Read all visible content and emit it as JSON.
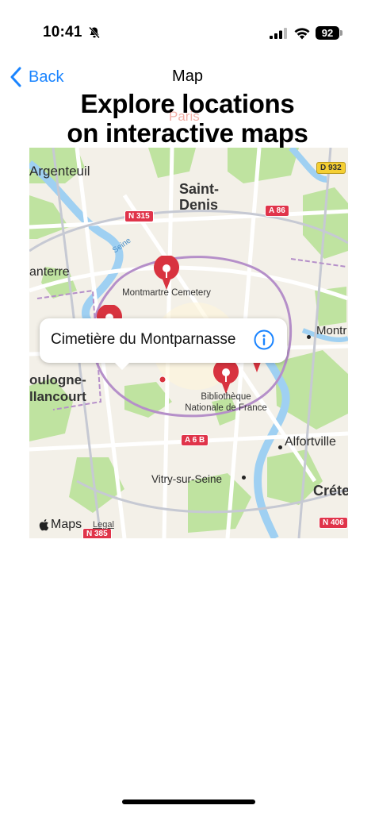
{
  "status_bar": {
    "time": "10:41",
    "battery_level": "92",
    "icons": [
      "bell-slash-icon",
      "cellular-signal-icon",
      "wifi-icon",
      "battery-icon"
    ]
  },
  "nav": {
    "back_label": "Back",
    "title": "Map"
  },
  "heading": {
    "line1": "Explore locations",
    "line2": "on interactive maps"
  },
  "map": {
    "ghost_label": "Paris",
    "place_labels": {
      "argenteuil": "Argenteuil",
      "saint_denis_1": "Saint-",
      "saint_denis_2": "Denis",
      "nanterre": "anterre",
      "montreuil": "Montr",
      "boulogne_1": "oulogne-",
      "boulogne_2": "llancourt",
      "alfortville": "Alfortville",
      "vitry": "Vitry-sur-Seine",
      "creteil": "Créte",
      "seine": "Seine"
    },
    "poi_labels": {
      "montmartre": "Montmartre Cemetery",
      "bnf_1": "Bibliothèque",
      "bnf_2": "Nationale de France"
    },
    "road_badges": {
      "d932": "D 932",
      "n315": "N 315",
      "a86": "A 86",
      "a6b": "A 6 B",
      "n406": "N 406",
      "n385": "N 385"
    },
    "attribution": "Maps",
    "legal_label": "Legal",
    "colors": {
      "land": "#f3f0e8",
      "park": "#bfe3a0",
      "water": "#9fd0f2",
      "pin": "#d8333f",
      "boundary": "#b58fc9"
    }
  },
  "callout": {
    "title": "Cimetière du Montparnasse",
    "info_icon": "info-circle-icon"
  }
}
